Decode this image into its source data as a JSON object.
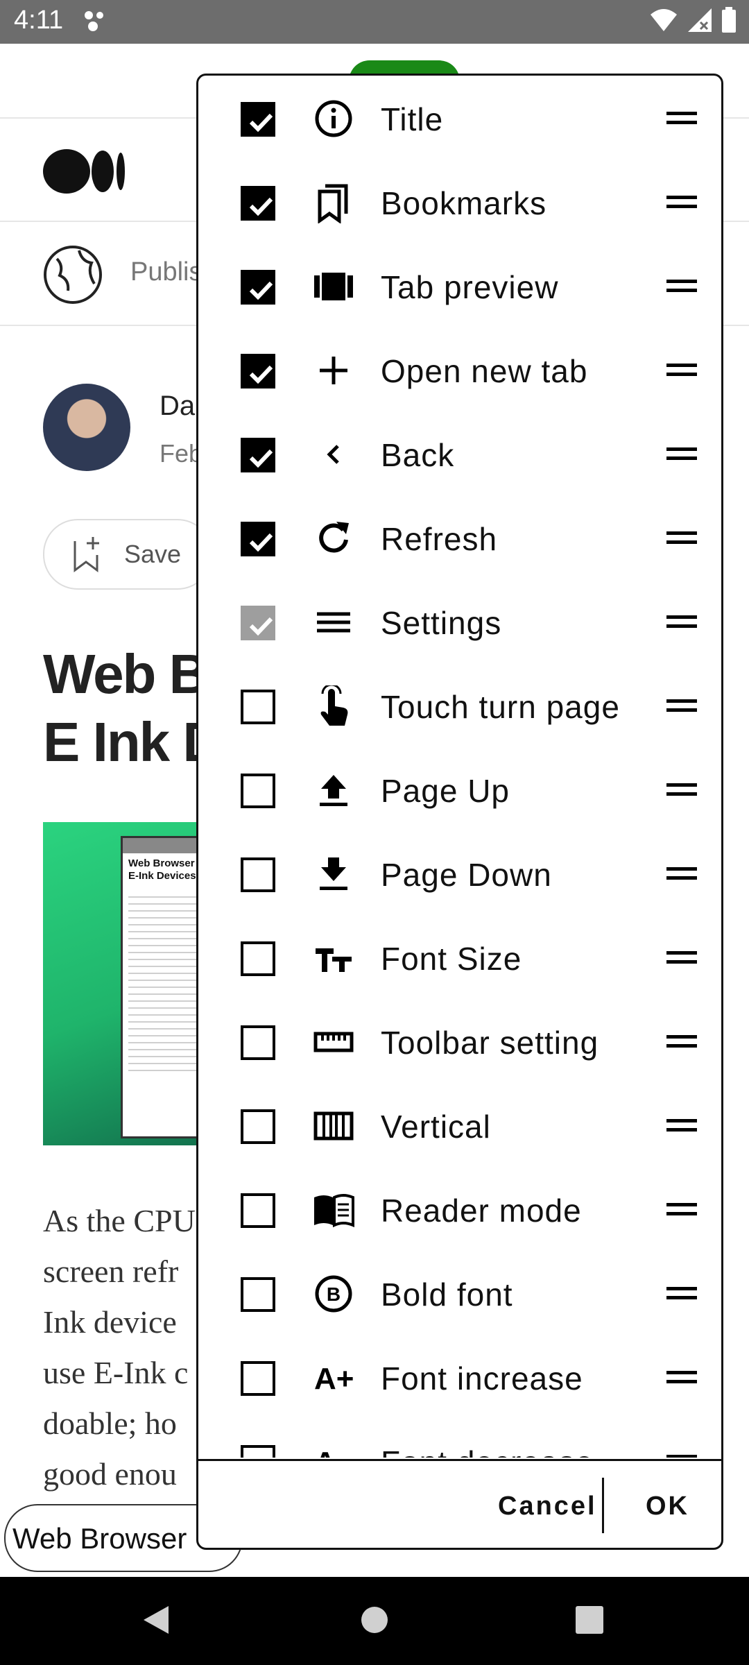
{
  "status_bar": {
    "time": "4:11"
  },
  "background": {
    "publisher_text": "Publis",
    "author_text": "Da",
    "date_text": "Feb",
    "save_label": "Save",
    "headline_line1": "Web B",
    "headline_line2": "E Ink D",
    "body_lines": [
      "As the CPU",
      "screen refr",
      "Ink device",
      "use E-Ink c",
      "doable; ho",
      "good enou"
    ],
    "url_text": "Web Browser",
    "preview": {
      "title_line1": "Web Browser",
      "title_line2": "E-Ink Devices"
    }
  },
  "dialog": {
    "items": [
      {
        "label": "Title",
        "icon": "info-icon",
        "state": "checked"
      },
      {
        "label": "Bookmarks",
        "icon": "bookmarks-icon",
        "state": "checked"
      },
      {
        "label": "Tab preview",
        "icon": "tab-preview-icon",
        "state": "checked"
      },
      {
        "label": "Open new tab",
        "icon": "plus-icon",
        "state": "checked"
      },
      {
        "label": "Back",
        "icon": "chevron-left-icon",
        "state": "checked"
      },
      {
        "label": "Refresh",
        "icon": "refresh-icon",
        "state": "checked"
      },
      {
        "label": "Settings",
        "icon": "menu-icon",
        "state": "checked-disabled"
      },
      {
        "label": "Touch turn page",
        "icon": "touch-icon",
        "state": "unchecked"
      },
      {
        "label": "Page Up",
        "icon": "page-up-icon",
        "state": "unchecked"
      },
      {
        "label": "Page Down",
        "icon": "page-down-icon",
        "state": "unchecked"
      },
      {
        "label": "Font Size",
        "icon": "font-size-icon",
        "state": "unchecked"
      },
      {
        "label": "Toolbar setting",
        "icon": "ruler-icon",
        "state": "unchecked"
      },
      {
        "label": "Vertical",
        "icon": "vertical-icon",
        "state": "unchecked"
      },
      {
        "label": "Reader mode",
        "icon": "book-icon",
        "state": "unchecked"
      },
      {
        "label": "Bold font",
        "icon": "bold-icon",
        "state": "unchecked"
      },
      {
        "label": "Font increase",
        "icon": "font-increase-icon",
        "state": "unchecked"
      },
      {
        "label": "Font decrease",
        "icon": "font-decrease-icon",
        "state": "unchecked"
      }
    ],
    "cancel_label": "Cancel",
    "ok_label": "OK"
  },
  "colors": {
    "accent_green": "#1a8917",
    "checkbox_disabled": "#9e9e9e",
    "status_bar": "#6d6d6d"
  }
}
